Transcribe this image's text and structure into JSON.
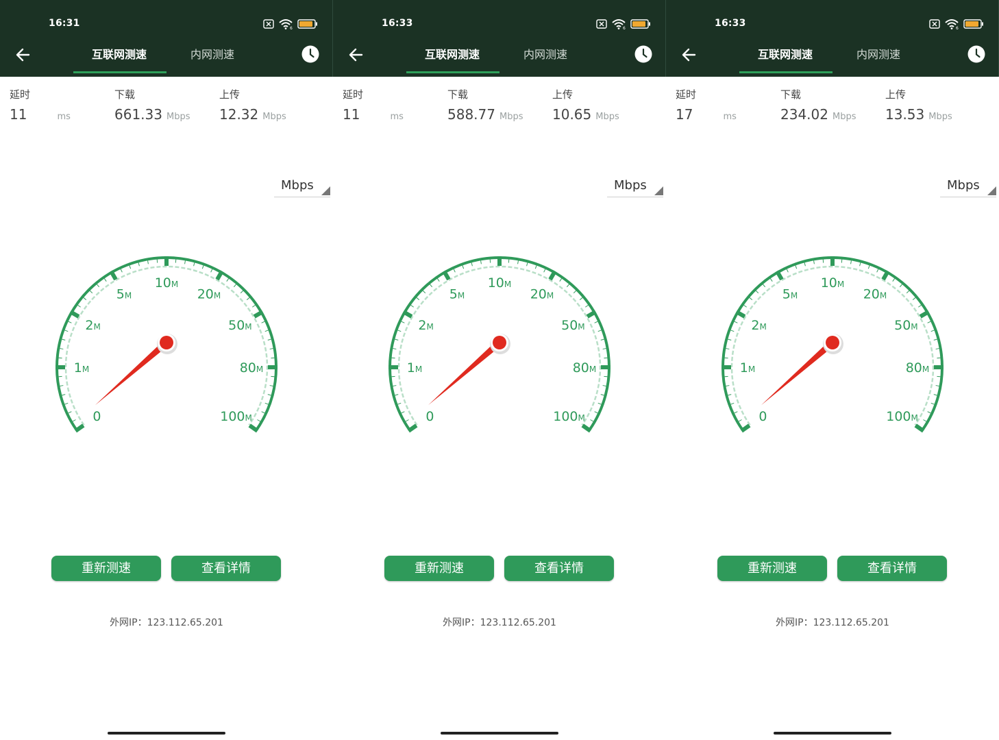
{
  "panels": [
    {
      "status": {
        "time": "16:31",
        "battery": "76"
      },
      "tabs": {
        "internet": "互联网测速",
        "intranet": "内网测速"
      },
      "metrics": {
        "latency_label": "延时",
        "latency_value": "11",
        "latency_unit": "ms",
        "download_label": "下载",
        "download_value": "661.33",
        "download_unit": "Mbps",
        "upload_label": "上传",
        "upload_value": "12.32",
        "upload_unit": "Mbps"
      },
      "unit_select": "Mbps",
      "gauge": {
        "labels": [
          "0",
          "1",
          "2",
          "5",
          "10",
          "20",
          "50",
          "80",
          "100"
        ],
        "unit_suffix": "M"
      },
      "buttons": {
        "retest": "重新测速",
        "detail": "查看详情"
      },
      "ip": "外网IP：123.112.65.201"
    },
    {
      "status": {
        "time": "16:33",
        "battery": "76"
      },
      "tabs": {
        "internet": "互联网测速",
        "intranet": "内网测速"
      },
      "metrics": {
        "latency_label": "延时",
        "latency_value": "11",
        "latency_unit": "ms",
        "download_label": "下载",
        "download_value": "588.77",
        "download_unit": "Mbps",
        "upload_label": "上传",
        "upload_value": "10.65",
        "upload_unit": "Mbps"
      },
      "unit_select": "Mbps",
      "gauge": {
        "labels": [
          "0",
          "1",
          "2",
          "5",
          "10",
          "20",
          "50",
          "80",
          "100"
        ],
        "unit_suffix": "M"
      },
      "buttons": {
        "retest": "重新测速",
        "detail": "查看详情"
      },
      "ip": "外网IP：123.112.65.201"
    },
    {
      "status": {
        "time": "16:33",
        "battery": "76"
      },
      "tabs": {
        "internet": "互联网测速",
        "intranet": "内网测速"
      },
      "metrics": {
        "latency_label": "延时",
        "latency_value": "17",
        "latency_unit": "ms",
        "download_label": "下载",
        "download_value": "234.02",
        "download_unit": "Mbps",
        "upload_label": "上传",
        "upload_value": "13.53",
        "upload_unit": "Mbps"
      },
      "unit_select": "Mbps",
      "gauge": {
        "labels": [
          "0",
          "1",
          "2",
          "5",
          "10",
          "20",
          "50",
          "80",
          "100"
        ],
        "unit_suffix": "M"
      },
      "buttons": {
        "retest": "重新测速",
        "detail": "查看详情"
      },
      "ip": "外网IP：123.112.65.201"
    }
  ],
  "colors": {
    "appbar": "#1b3224",
    "accent": "#2f9a5a",
    "needle": "#e02a1f"
  }
}
